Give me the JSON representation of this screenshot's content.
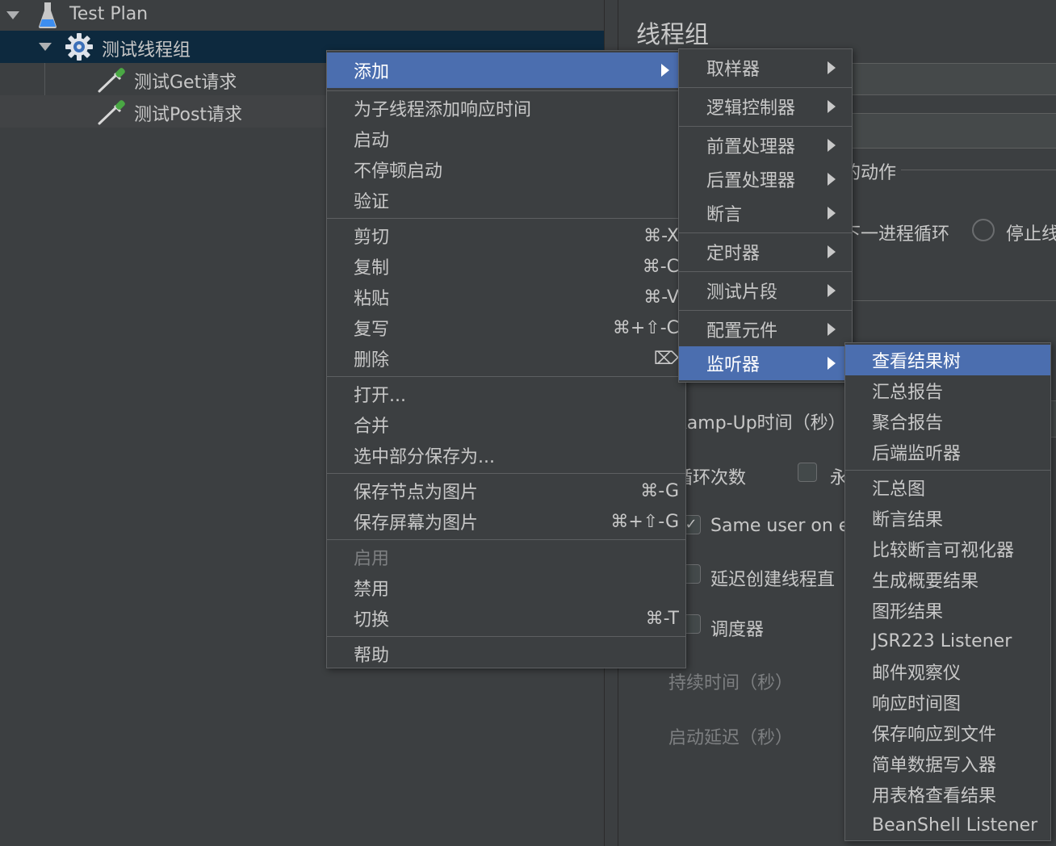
{
  "tree": {
    "items": [
      {
        "label": "Test Plan",
        "icon": "flask-icon"
      },
      {
        "label": "测试线程组",
        "icon": "gear-icon"
      },
      {
        "label": "测试Get请求",
        "icon": "pipette-icon"
      },
      {
        "label": "测试Post请求",
        "icon": "pipette-icon"
      }
    ]
  },
  "panel": {
    "title": "线程组",
    "action_suffix": "的动作",
    "next_loop": "下一进程循环",
    "stop_thread": "停止线",
    "ramp_up": "Ramp-Up时间（秒）",
    "loop_count": "循环次数",
    "forever": "永",
    "same_user": "Same user on e",
    "delay_create": "延迟创建线程直",
    "scheduler": "调度器",
    "duration": "持续时间（秒）",
    "startup_delay": "启动延迟（秒）"
  },
  "context_menu": {
    "items": [
      {
        "label": "添加",
        "submenu": true,
        "active": true
      },
      {
        "sep": true
      },
      {
        "label": "为子线程添加响应时间"
      },
      {
        "label": "启动"
      },
      {
        "label": "不停顿启动"
      },
      {
        "label": "验证"
      },
      {
        "sep": true
      },
      {
        "label": "剪切",
        "shortcut": "⌘-X"
      },
      {
        "label": "复制",
        "shortcut": "⌘-C"
      },
      {
        "label": "粘贴",
        "shortcut": "⌘-V"
      },
      {
        "label": "复写",
        "shortcut": "⌘+⇧-C"
      },
      {
        "label": "删除",
        "shortcut": "⌦"
      },
      {
        "sep": true
      },
      {
        "label": "打开..."
      },
      {
        "label": "合并"
      },
      {
        "label": "选中部分保存为..."
      },
      {
        "sep": true
      },
      {
        "label": "保存节点为图片",
        "shortcut": "⌘-G"
      },
      {
        "label": "保存屏幕为图片",
        "shortcut": "⌘+⇧-G"
      },
      {
        "sep": true
      },
      {
        "label": "启用",
        "disabled": true
      },
      {
        "label": "禁用"
      },
      {
        "label": "切换",
        "shortcut": "⌘-T"
      },
      {
        "sep": true
      },
      {
        "label": "帮助"
      }
    ]
  },
  "add_submenu": {
    "items": [
      {
        "label": "取样器"
      },
      {
        "sep": true
      },
      {
        "label": "逻辑控制器"
      },
      {
        "sep": true
      },
      {
        "label": "前置处理器"
      },
      {
        "label": "后置处理器"
      },
      {
        "label": "断言"
      },
      {
        "sep": true
      },
      {
        "label": "定时器"
      },
      {
        "sep": true
      },
      {
        "label": "测试片段"
      },
      {
        "sep": true
      },
      {
        "label": "配置元件"
      },
      {
        "label": "监听器",
        "active": true
      }
    ]
  },
  "listener_submenu": {
    "items": [
      {
        "label": "查看结果树",
        "active": true
      },
      {
        "label": "汇总报告"
      },
      {
        "label": "聚合报告"
      },
      {
        "label": "后端监听器"
      },
      {
        "sep": true
      },
      {
        "label": "汇总图"
      },
      {
        "label": "断言结果"
      },
      {
        "label": "比较断言可视化器"
      },
      {
        "label": "生成概要结果"
      },
      {
        "label": "图形结果"
      },
      {
        "label": "JSR223 Listener"
      },
      {
        "label": "邮件观察仪"
      },
      {
        "label": "响应时间图"
      },
      {
        "label": "保存响应到文件"
      },
      {
        "label": "简单数据写入器"
      },
      {
        "label": "用表格查看结果"
      },
      {
        "label": "BeanShell Listener"
      }
    ]
  },
  "colors": {
    "background": "#3c3f41",
    "menu_highlight": "#4b6eaf",
    "tree_selection": "#0d293e",
    "text": "#c8c8c8"
  }
}
